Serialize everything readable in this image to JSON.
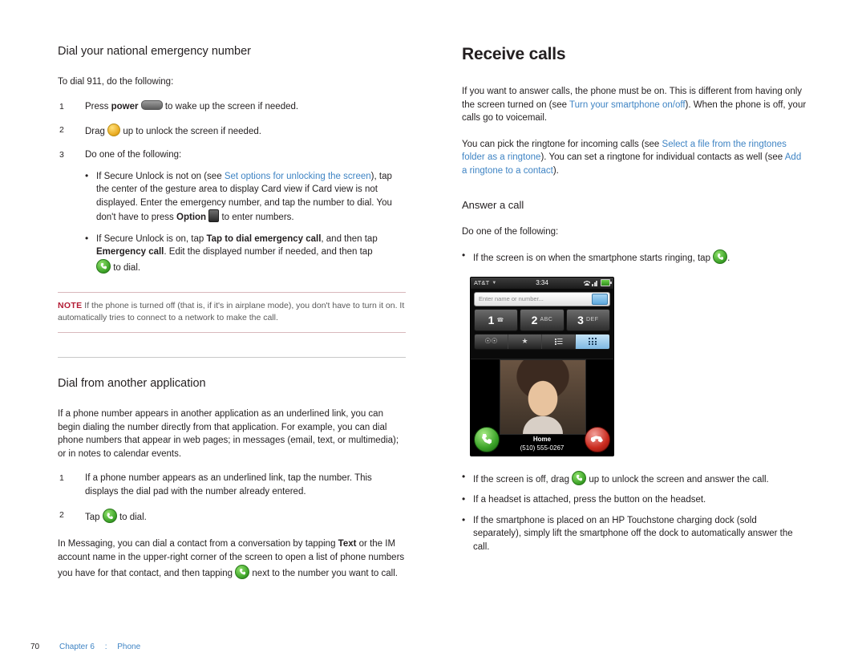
{
  "left": {
    "heading": "Dial your national emergency number",
    "intro": "To dial 911, do the following:",
    "steps": [
      {
        "num": "1",
        "pre": "Press ",
        "bold": "power",
        "post": " to wake up the screen if needed.",
        "icon": "power-button-icon"
      },
      {
        "num": "2",
        "pre": "Drag ",
        "post": " up to unlock the screen if needed.",
        "icon": "unlock-orb-icon"
      },
      {
        "num": "3",
        "pre": "Do one of the following:",
        "post": ""
      }
    ],
    "substeps": [
      {
        "t1": "If Secure Unlock is not on (see ",
        "link": "Set options for unlocking the screen",
        "t2": "), tap the center of the gesture area to display Card view if Card view is not displayed. Enter the emergency number, and tap the number to dial. You don't have to press ",
        "bold": "Option",
        "t3": " to enter numbers.",
        "icon": "option-key-icon"
      },
      {
        "t1": "If Secure Unlock is on, tap ",
        "bold1": "Tap to dial emergency call",
        "t2": ", and then tap ",
        "bold2": "Emergency call",
        "t3": ". Edit the displayed number if needed, and then tap ",
        "t4": " to dial.",
        "icon": "green-phone-icon"
      }
    ],
    "note": {
      "label": "NOTE",
      "text": "If the phone is turned off (that is, if it's in airplane mode), you don't have to turn it on. It automatically tries to connect to a network to make the call."
    },
    "heading2": "Dial from another application",
    "para1": "If a phone number appears in another application as an underlined link, you can begin dialing the number directly from that application. For example, you can dial phone numbers that appear in web pages; in messages (email, text, or multimedia); or in notes to calendar events.",
    "steps2": [
      {
        "num": "1",
        "text": "If a phone number appears as an underlined link, tap the number. This displays the dial pad with the number already entered."
      },
      {
        "num": "2",
        "pre": "Tap ",
        "post": " to dial.",
        "icon": "green-phone-icon"
      }
    ],
    "para2a": "In Messaging, you can dial a contact from a conversation by tapping ",
    "para2bold": "Text",
    "para2b": " or the IM account name in the upper-right corner of the screen to open a list of phone numbers you have for that contact, and then tapping ",
    "para2c": " next to the number you want to call."
  },
  "right": {
    "title": "Receive calls",
    "para1a": "If you want to answer calls, the phone must be on. This is different from having only the screen turned on (see ",
    "para1link": "Turn your smartphone on/off",
    "para1b": "). When the phone is off, your calls go to voicemail.",
    "para2a": "You can pick the ringtone for incoming calls (see ",
    "para2link1": "Select a file from the ringtones folder as a ringtone",
    "para2b": "). You can set a ringtone for individual contacts as well (see ",
    "para2link2": "Add a ringtone to a contact",
    "para2c": ").",
    "subhead": "Answer a call",
    "intro": "Do one of the following:",
    "bullet1a": "If the screen is on when the smartphone starts ringing, tap ",
    "bullet1b": ".",
    "bullets": [
      {
        "a": "If the screen is off, drag ",
        "b": " up to unlock the screen and answer the call.",
        "icon": "unlock-green-icon"
      },
      {
        "a": "If a headset is attached, press the button on the headset.",
        "b": "",
        "icon": ""
      },
      {
        "a": "If the smartphone is placed on an HP Touchstone charging dock (sold separately), simply lift the smartphone off the dock to automatically answer the call.",
        "b": "",
        "icon": ""
      }
    ]
  },
  "phone_screenshot": {
    "carrier": "AT&T",
    "time": "3:34",
    "entry_placeholder": "Enter name or number...",
    "keys": [
      {
        "digit": "1",
        "letters": "voicemail"
      },
      {
        "digit": "2",
        "letters": "ABC"
      },
      {
        "digit": "3",
        "letters": "DEF"
      }
    ],
    "tabs": [
      "voicemail",
      "favorites",
      "list",
      "dialpad"
    ],
    "contact_name": "Home",
    "contact_number": "(510) 555-0267",
    "answer_label": "answer-call",
    "end_label": "end-call"
  },
  "footer": {
    "pagenum": "70",
    "chapter": "Chapter 6  :  Phone"
  },
  "colors": {
    "link": "#3f84c4",
    "note": "#b31b34",
    "text": "#231f20"
  }
}
